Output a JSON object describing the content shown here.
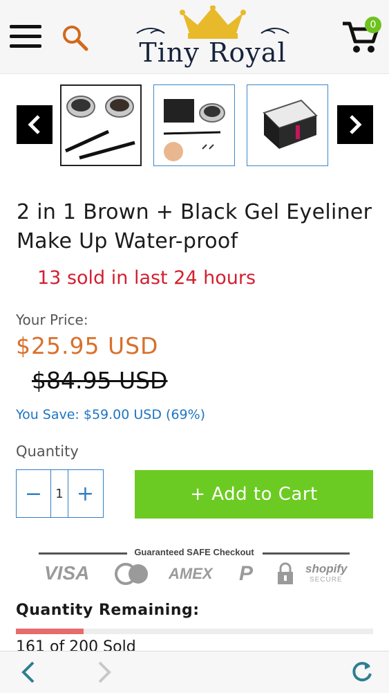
{
  "header": {
    "brand": "Tiny Royal",
    "cart_count": "0"
  },
  "gallery": {
    "thumbnails": [
      "eyeliner-jars-with-brushes",
      "eyeliner-with-box-and-brushes",
      "eyeliner-packaging-box"
    ],
    "active_index": 0
  },
  "product": {
    "title": "2 in 1 Brown + Black Gel Eyeliner Make Up Water-proof",
    "sold_recent": "13 sold in last 24 hours",
    "price_label": "Your Price:",
    "price": "$25.95 USD",
    "compare_price": "$84.95 USD",
    "you_save": "You Save: $59.00 USD (69%)"
  },
  "purchase": {
    "quantity_label": "Quantity",
    "quantity_value": "1",
    "minus": "−",
    "plus": "+",
    "add_to_cart": "+ Add to Cart"
  },
  "secure": {
    "title": "Guaranteed SAFE Checkout",
    "badges": {
      "visa": "VISA",
      "amex": "AMEX",
      "paypal": "P",
      "shopify": "shopify",
      "shopify_sub": "SECURE"
    }
  },
  "stock": {
    "label": "Quantity Remaining:",
    "sold_text": "161 of 200 Sold",
    "progress_fraction": 0.19
  },
  "colors": {
    "price": "#d9702b",
    "urgency": "#d22030",
    "save": "#1d75c3",
    "cart_button": "#6ccb22",
    "accent": "#2f7fc4"
  }
}
